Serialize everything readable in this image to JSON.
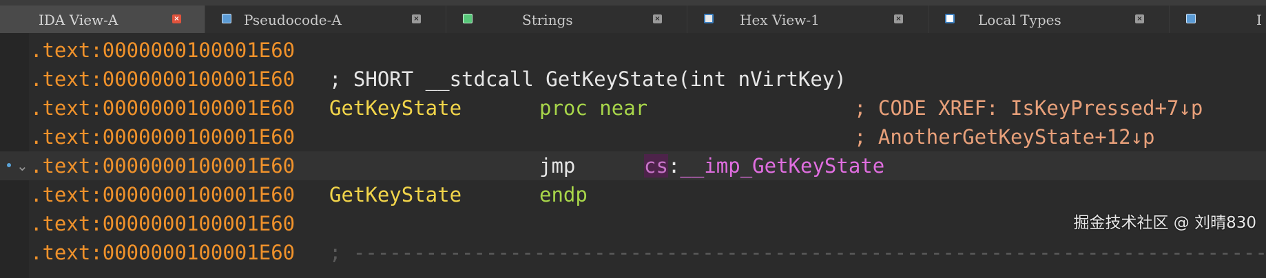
{
  "tabs": [
    {
      "label": "IDA View-A",
      "icon": "ida-view-icon",
      "active": true
    },
    {
      "label": "Pseudocode-A",
      "icon": "pseudocode-icon"
    },
    {
      "label": "Strings",
      "icon": "strings-icon"
    },
    {
      "label": "Hex View-1",
      "icon": "hex-view-icon"
    },
    {
      "label": "Local Types",
      "icon": "local-types-icon"
    },
    {
      "label": "I",
      "icon": "next-tab-icon"
    }
  ],
  "close_glyph": "×",
  "colors": {
    "address": "#f0922b",
    "comment": "#e8a07a",
    "name": "#f2d54a",
    "keyword": "#a8d64a",
    "register": "#c874c9",
    "symbol": "#e06ee0",
    "active_tab_close": "#e0533d"
  },
  "lines": [
    {
      "addr": ".text:0000000100001E60"
    },
    {
      "addr": ".text:0000000100001E60",
      "comment": "; SHORT __stdcall GetKeyState(int nVirtKey)"
    },
    {
      "addr": ".text:0000000100001E60",
      "name": "GetKeyState",
      "kw": "proc near",
      "xref": "; CODE XREF: IsKeyPressed+7↓p"
    },
    {
      "addr": ".text:0000000100001E60",
      "xref": "; AnotherGetKeyState+12↓p"
    },
    {
      "addr": ".text:0000000100001E60",
      "mnemonic": "jmp",
      "reg": "cs",
      "colon": ":",
      "operand": "__imp_GetKeyState",
      "fold": "⌄"
    },
    {
      "addr": ".text:0000000100001E60",
      "name": "GetKeyState",
      "kw": "endp"
    },
    {
      "addr": ".text:0000000100001E60"
    },
    {
      "addr": ".text:0000000100001E60",
      "sep": "; -----------------------------------------------------------------------------------------"
    }
  ],
  "watermark": "掘金技术社区 @ 刘晴830"
}
